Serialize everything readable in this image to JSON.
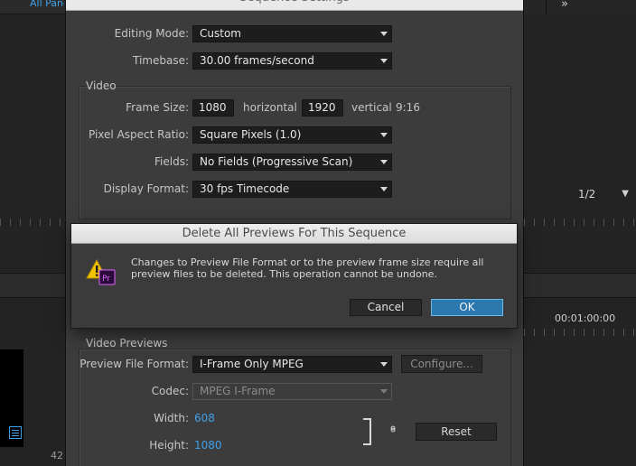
{
  "background": {
    "panels_tab_label": "All Panels",
    "overflow_label": "»",
    "zoom_select_value": "1/2",
    "timecode": "00:01:00:00",
    "frame_number": "42"
  },
  "sequence_settings": {
    "title": "Sequence Settings",
    "editing_mode_label": "Editing Mode:",
    "editing_mode_value": "Custom",
    "timebase_label": "Timebase:",
    "timebase_value": "30.00 frames/second",
    "video_group_title": "Video",
    "frame_size_label": "Frame Size:",
    "frame_width": "1080",
    "horizontal_label": "horizontal",
    "frame_height": "1920",
    "vertical_label": "vertical",
    "aspect_ratio_text": "9:16",
    "pixel_aspect_label": "Pixel Aspect Ratio:",
    "pixel_aspect_value": "Square Pixels (1.0)",
    "fields_label": "Fields:",
    "fields_value": "No Fields (Progressive Scan)",
    "display_format_label": "Display Format:",
    "display_format_value": "30 fps Timecode",
    "video_previews_title": "Video Previews",
    "preview_format_label": "Preview File Format:",
    "preview_format_value": "I-Frame Only MPEG",
    "configure_label": "Configure...",
    "codec_label": "Codec:",
    "codec_value": "MPEG I-Frame",
    "width_label": "Width:",
    "width_value": "608",
    "height_label": "Height:",
    "height_value": "1080",
    "reset_label": "Reset"
  },
  "dialog": {
    "title": "Delete All Previews For This Sequence",
    "message_line1": "Changes to Preview File Format or to the preview frame size require all",
    "message_line2": "preview files to be deleted. This operation cannot be undone.",
    "icon_badge": "Pr",
    "cancel_label": "Cancel",
    "ok_label": "OK"
  },
  "colors": {
    "accent_blue": "#3ea1e8",
    "ok_button": "#2b78ae",
    "warning_yellow": "#f2c200",
    "premiere_purple": "#2a0a3a"
  }
}
